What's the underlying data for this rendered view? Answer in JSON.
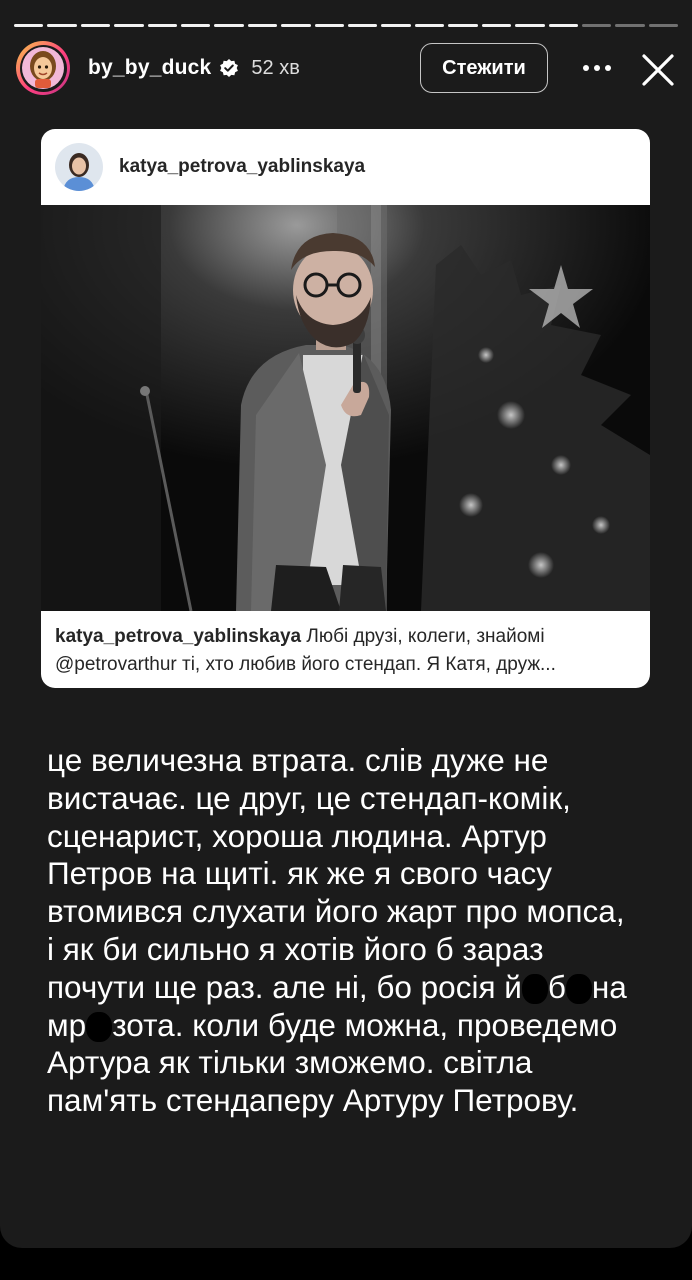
{
  "header": {
    "username": "by_by_duck",
    "time": "52 хв",
    "follow_label": "Стежити",
    "avatar_icon": "cartoon-avatar-icon",
    "verified_icon": "verified-badge-icon",
    "more_icon": "more-dots-icon",
    "close_icon": "close-icon"
  },
  "progress": {
    "total_segments": 20,
    "completed_segments": 17
  },
  "shared_post": {
    "author": "katya_petrova_yablinskaya",
    "caption_user": "katya_petrova_yablinskaya",
    "caption_line1": " Любі друзі, колеги, знайомі",
    "caption_line2": "@petrovarthur ті, хто любив його стендап. Я Катя, друж..."
  },
  "story_text": {
    "lines": [
      "це величезна втрата. слів дуже не",
      "вистачає. це друг, це стендап-комік,",
      "сценарист, хороша людина. Артур",
      "Петров на щиті. як же я свого часу",
      "втомився слухати його жарт про мопса,",
      "і як би сильно я хотів його б зараз"
    ],
    "line7_a": "почути ще раз. але ні, бо росія й",
    "line7_b": "б",
    "line7_c": "на",
    "line8_a": "мр",
    "line8_b": "зота. коли буде можна, проведемо",
    "line9": "Артура як тільки зможемо. світла",
    "line10": "пам'ять стендаперу Артуру Петрову."
  },
  "colors": {
    "story_background": "#1b1b1b",
    "card_background": "#ffffff",
    "text_primary": "#ffffff",
    "card_text": "#262626"
  }
}
